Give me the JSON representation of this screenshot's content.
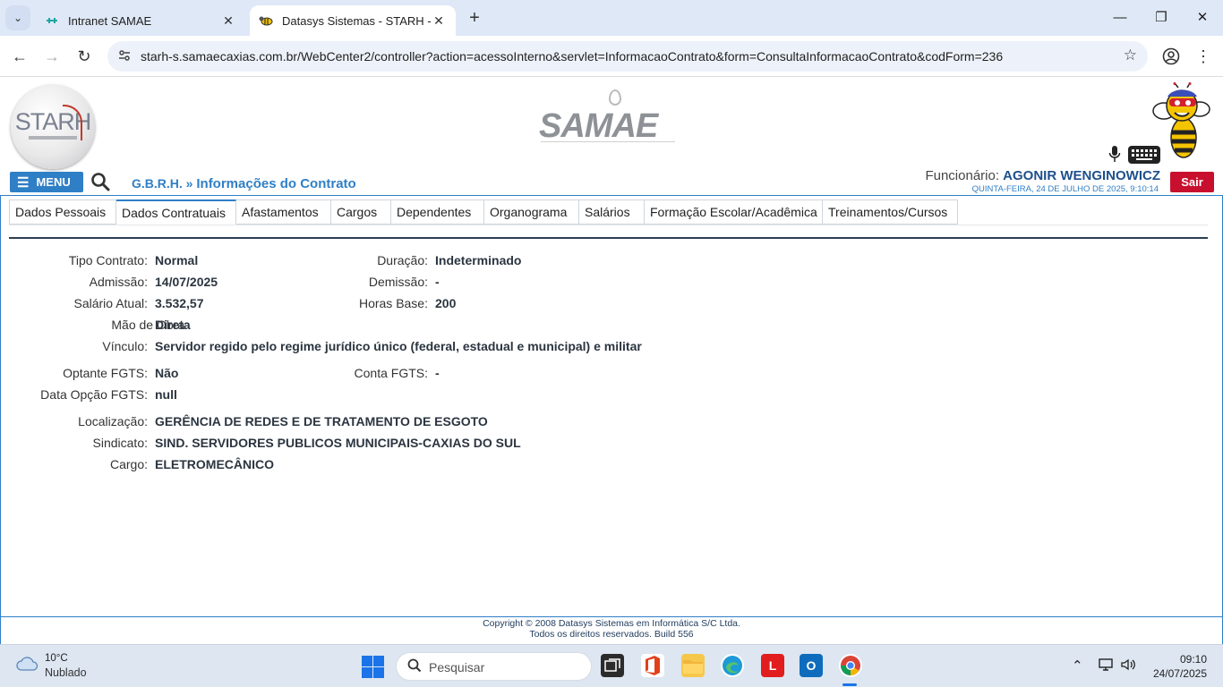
{
  "browser": {
    "tabs": [
      {
        "title": "Intranet SAMAE",
        "active": false
      },
      {
        "title": "Datasys Sistemas - STARH - We",
        "active": true
      }
    ],
    "url": "starh-s.samaecaxias.com.br/WebCenter2/controller?action=acessoInterno&servlet=InformacaoContrato&form=ConsultaInformacaoContrato&codForm=236"
  },
  "header": {
    "menu_label": "MENU",
    "breadcrumb_prefix": "G.B.R.H. »",
    "page_title": "Informações do Contrato",
    "employee_label": "Funcionário:",
    "employee_name": "AGONIR WENGINOWICZ",
    "datetime": "QUINTA-FEIRA, 24 DE JULHO DE 2025, 9:10:14",
    "logout_label": "Sair",
    "logo_left": "STARH",
    "logo_center": "SAMAE"
  },
  "tabs": [
    {
      "label": "Dados Pessoais",
      "active": false
    },
    {
      "label": "Dados Contratuais",
      "active": true
    },
    {
      "label": "Afastamentos",
      "active": false
    },
    {
      "label": "Cargos",
      "active": false
    },
    {
      "label": "Dependentes",
      "active": false
    },
    {
      "label": "Organograma",
      "active": false
    },
    {
      "label": "Salários",
      "active": false
    },
    {
      "label": "Formação Escolar/Acadêmica",
      "active": false
    },
    {
      "label": "Treinamentos/Cursos",
      "active": false
    }
  ],
  "contract": {
    "tipo_contrato": {
      "label": "Tipo Contrato:",
      "value": "Normal"
    },
    "admissao": {
      "label": "Admissão:",
      "value": "14/07/2025"
    },
    "salario_atual": {
      "label": "Salário Atual:",
      "value": "3.532,57"
    },
    "mao_de_obra": {
      "label": "Mão de Obra:",
      "value": "Direta"
    },
    "vinculo": {
      "label": "Vínculo:",
      "value": "Servidor regido pelo regime jurídico único (federal, estadual e municipal) e militar"
    },
    "duracao": {
      "label": "Duração:",
      "value": "Indeterminado"
    },
    "demissao": {
      "label": "Demissão:",
      "value": "-"
    },
    "horas_base": {
      "label": "Horas Base:",
      "value": "200"
    },
    "optante_fgts": {
      "label": "Optante FGTS:",
      "value": "Não"
    },
    "conta_fgts": {
      "label": "Conta FGTS:",
      "value": "-"
    },
    "data_opcao_fgts": {
      "label": "Data Opção FGTS:",
      "value": "null"
    },
    "localizacao": {
      "label": "Localização:",
      "value": "GERÊNCIA DE REDES E DE TRATAMENTO DE ESGOTO"
    },
    "sindicato": {
      "label": "Sindicato:",
      "value": "SIND. SERVIDORES PUBLICOS MUNICIPAIS-CAXIAS DO SUL"
    },
    "cargo": {
      "label": "Cargo:",
      "value": "ELETROMECÂNICO"
    }
  },
  "footer": {
    "line1": "Copyright © 2008 Datasys Sistemas em Informática S/C Ltda.",
    "line2": "Todos os direitos reservados. Build 556"
  },
  "taskbar": {
    "temperature": "10°C",
    "condition": "Nublado",
    "search_placeholder": "Pesquisar",
    "time": "09:10",
    "date": "24/07/2025"
  },
  "colors": {
    "accent": "#2f7fc6",
    "logout": "#c8102e",
    "tab_bar": "#dfe8f7"
  }
}
